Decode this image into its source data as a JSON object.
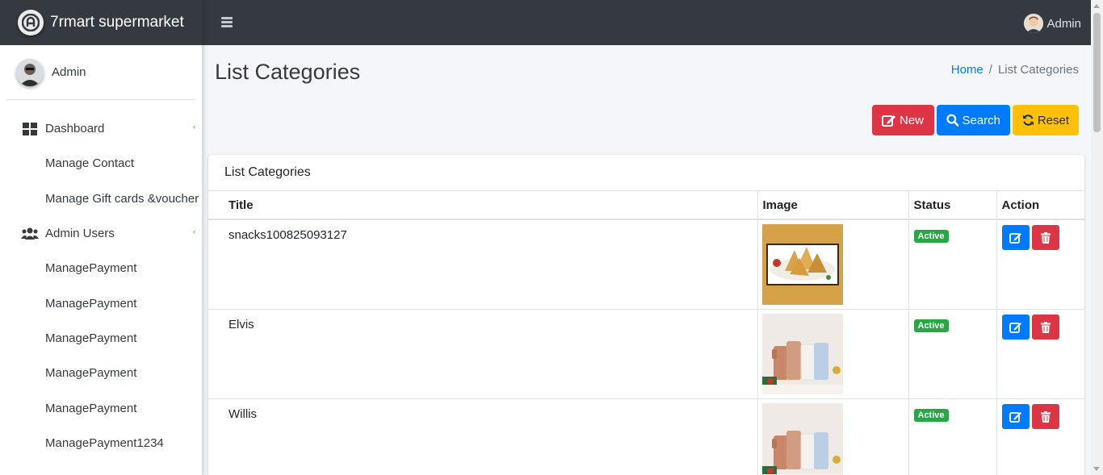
{
  "app": {
    "brand": "7rmart supermarket"
  },
  "sidebar": {
    "user": "Admin",
    "items": [
      {
        "label": "Dashboard",
        "icon": "dashboard-icon",
        "caret": "‹"
      },
      {
        "label": "Manage Contact"
      },
      {
        "label": "Manage Gift cards &voucher"
      },
      {
        "label": "Admin Users",
        "icon": "users-icon",
        "caret": "‹"
      },
      {
        "label": "ManagePayment"
      },
      {
        "label": "ManagePayment"
      },
      {
        "label": "ManagePayment"
      },
      {
        "label": "ManagePayment"
      },
      {
        "label": "ManagePayment"
      },
      {
        "label": "ManagePayment1234"
      }
    ]
  },
  "topbar": {
    "user": "Admin"
  },
  "page": {
    "title": "List Categories",
    "breadcrumb": {
      "home": "Home",
      "separator": "/",
      "current": "List Categories"
    }
  },
  "actions": {
    "new": "New",
    "search": "Search",
    "reset": "Reset"
  },
  "card": {
    "title": "List Categories",
    "columns": [
      "Title",
      "Image",
      "Status",
      "Action"
    ],
    "rows": [
      {
        "title": "snacks100825093127",
        "image": "samosa-photo",
        "status": "Active"
      },
      {
        "title": "Elvis",
        "image": "tumblers-photo",
        "status": "Active"
      },
      {
        "title": "Willis",
        "image": "tumblers-photo",
        "status": "Active"
      }
    ]
  },
  "colors": {
    "accent": "#007bff",
    "danger": "#dc3545",
    "warning": "#ffc107",
    "success": "#28a745",
    "dark": "#343a40"
  }
}
